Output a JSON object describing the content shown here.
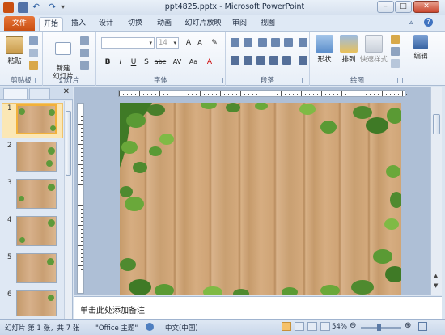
{
  "window": {
    "title": "ppt4825.pptx - Microsoft PowerPoint",
    "buttons": {
      "minimize": "–",
      "maximize": "□",
      "close": "✕"
    }
  },
  "tabs": [
    {
      "label": "文件"
    },
    {
      "label": "开始"
    },
    {
      "label": "插入"
    },
    {
      "label": "设计"
    },
    {
      "label": "切换"
    },
    {
      "label": "动画"
    },
    {
      "label": "幻灯片放映"
    },
    {
      "label": "审阅"
    },
    {
      "label": "视图"
    }
  ],
  "ribbon": {
    "clipboard": {
      "label": "剪贴板",
      "paste": "粘贴"
    },
    "slides": {
      "label": "幻灯片",
      "new_slide": "新建\n幻灯片"
    },
    "font": {
      "label": "字体",
      "font_size": "14",
      "bold": "B",
      "italic": "I",
      "underline": "U",
      "strike": "S",
      "shadow": "abc",
      "char_spacing": "AV",
      "case": "Aa",
      "color": "A"
    },
    "paragraph": {
      "label": "段落"
    },
    "drawing": {
      "label": "绘图",
      "shapes": "形状",
      "arrange": "排列",
      "quick_styles": "快速样式"
    },
    "editing": {
      "label": "编辑",
      "edit": "编辑"
    }
  },
  "pane": {
    "tab_outline": "",
    "tab_slides": "",
    "close": "✕",
    "slides": [
      {
        "num": "1"
      },
      {
        "num": "2"
      },
      {
        "num": "3"
      },
      {
        "num": "4"
      },
      {
        "num": "5"
      },
      {
        "num": "6"
      }
    ]
  },
  "notes": {
    "placeholder": "单击此处添加备注"
  },
  "status": {
    "slide_info": "幻灯片 第 1 张，共 7 张",
    "theme": "\"Office 主题\"",
    "language": "中文(中国)",
    "zoom": "54%"
  },
  "colors": {
    "file_tab": "#c94f12",
    "accent": "#f2b13a",
    "ribbon_bg": "#fbfcfe"
  }
}
